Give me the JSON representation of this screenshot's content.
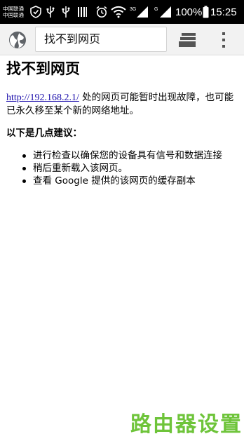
{
  "status_bar": {
    "carrier_line1": "中国联通",
    "carrier_line2": "中国联通",
    "network_label_1": "3G",
    "network_label_2": "G",
    "battery_percent": "100%",
    "time": "15:25"
  },
  "toolbar": {
    "url_text": "找不到网页"
  },
  "page": {
    "title": "找不到网页",
    "link": "http://192.168.2.1/",
    "desc_rest": " 处的网页可能暂时出现故障，也可能已永久移至某个新的网络地址。",
    "suggest_heading": "以下是几点建议：",
    "suggestions": [
      "进行检查以确保您的设备具有信号和数据连接",
      "稍后重新载入该网页。",
      "查看 Google 提供的该网页的缓存副本"
    ]
  },
  "watermark": "路由器设置",
  "colors": {
    "link": "#1a0dab",
    "watermark": "#6ec43a",
    "status_bar": "#000000",
    "toolbar": "#f2f2f2"
  }
}
